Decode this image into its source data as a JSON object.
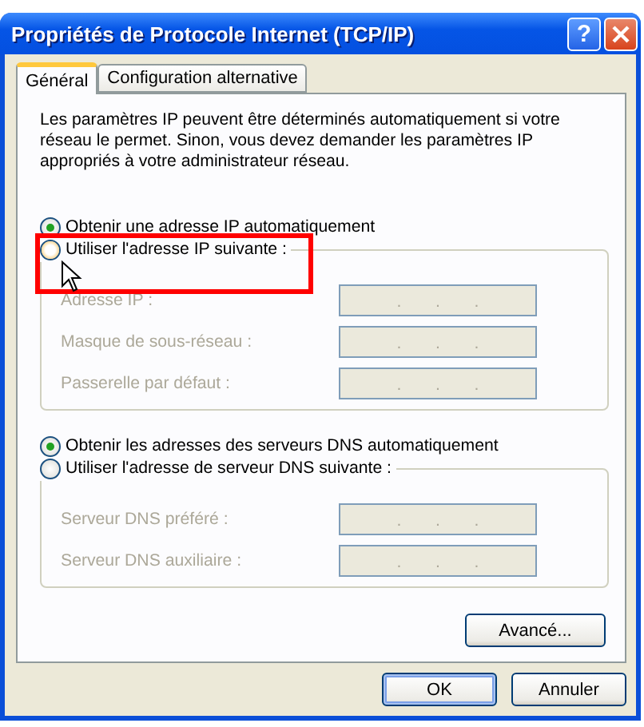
{
  "window": {
    "title": "Propriétés de Protocole Internet (TCP/IP)",
    "help": "?"
  },
  "tabs": [
    {
      "label": "Général",
      "selected": true
    },
    {
      "label": "Configuration alternative",
      "selected": false
    }
  ],
  "intro": "Les paramètres IP peuvent être déterminés automatiquement si votre\nréseau le permet. Sinon, vous devez demander les paramètres IP\nappropriés à votre administrateur réseau.",
  "sections": [
    {
      "auto": {
        "label": "Obtenir une adresse IP automatiquement",
        "selected": true
      },
      "manual": {
        "label": "Utiliser l'adresse IP suivante :",
        "selected": false,
        "hover": true
      },
      "fields": [
        {
          "label": "Adresse IP :",
          "disabled": true,
          "separator": "."
        },
        {
          "label": "Masque de sous-réseau :",
          "disabled": true,
          "separator": "."
        },
        {
          "label": "Passerelle par défaut :",
          "disabled": true,
          "separator": "."
        }
      ]
    },
    {
      "auto": {
        "label": "Obtenir les adresses des serveurs DNS automatiquement",
        "selected": true
      },
      "manual": {
        "label": "Utiliser l'adresse de serveur DNS suivante :",
        "selected": false,
        "hover": false
      },
      "fields": [
        {
          "label": "Serveur DNS préféré :",
          "disabled": true,
          "separator": "."
        },
        {
          "label": "Serveur DNS auxiliaire :",
          "disabled": true,
          "separator": "."
        }
      ]
    }
  ],
  "advanced_button": "Avancé...",
  "buttons": [
    {
      "label": "OK",
      "default": true
    },
    {
      "label": "Annuler",
      "default": false
    }
  ]
}
